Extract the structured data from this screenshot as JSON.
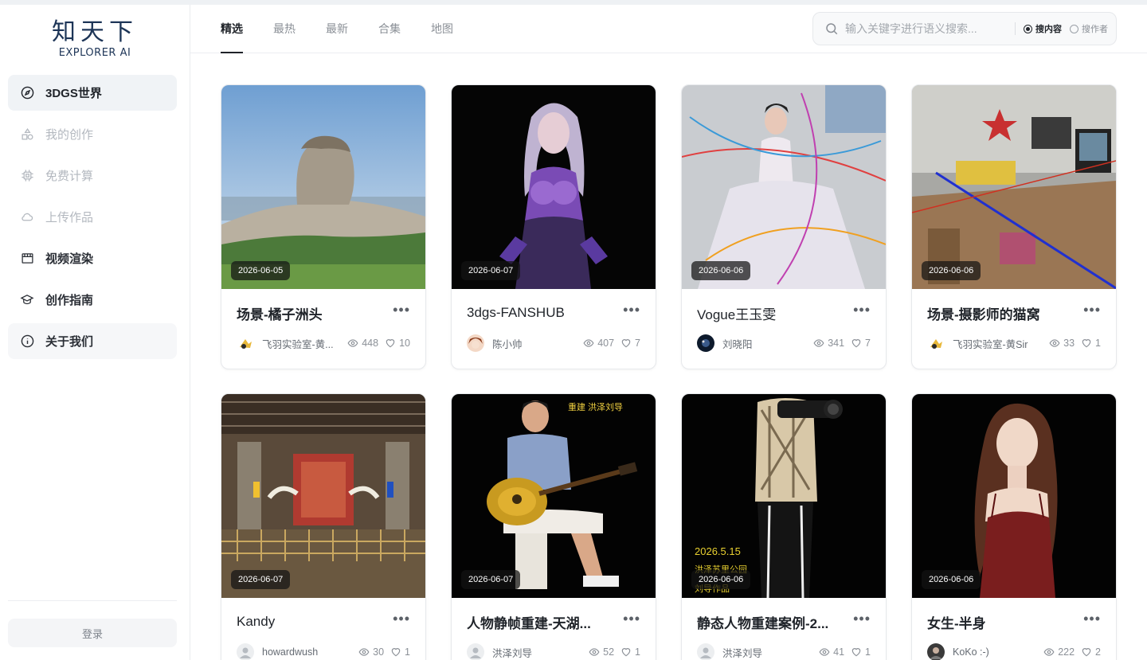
{
  "brand": {
    "name_cn": "知天下",
    "name_en": "EXPLORER AI"
  },
  "sidebar": {
    "items": [
      {
        "label": "3DGS世界",
        "icon": "compass-icon"
      },
      {
        "label": "我的创作",
        "icon": "shapes-icon"
      },
      {
        "label": "免费计算",
        "icon": "chip-icon"
      },
      {
        "label": "上传作品",
        "icon": "cloud-icon"
      },
      {
        "label": "视频渲染",
        "icon": "clapper-icon"
      },
      {
        "label": "创作指南",
        "icon": "graduation-cap-icon"
      },
      {
        "label": "关于我们",
        "icon": "info-icon"
      }
    ],
    "login_label": "登录"
  },
  "tabs": [
    "精选",
    "最热",
    "最新",
    "合集",
    "地图"
  ],
  "search": {
    "placeholder": "输入关键字进行语义搜索...",
    "options": [
      "搜内容",
      "搜作者"
    ],
    "selected": "搜内容"
  },
  "cards": [
    {
      "date": "2026-06-05",
      "title": "场景-橘子洲头",
      "author": "飞羽实验室-黄...",
      "views": "448",
      "likes": "10"
    },
    {
      "date": "2026-06-07",
      "title": "3dgs-FANSHUB",
      "author": "陈小帅",
      "views": "407",
      "likes": "7"
    },
    {
      "date": "2026-06-06",
      "title": "Vogue王玉雯",
      "author": "刘晓阳",
      "views": "341",
      "likes": "7"
    },
    {
      "date": "2026-06-06",
      "title": "场景-摄影师的猫窝",
      "author": "飞羽实验室-黄Sir",
      "views": "33",
      "likes": "1"
    },
    {
      "date": "2026-06-07",
      "title": "Kandy",
      "author": "howardwush",
      "views": "30",
      "likes": "1"
    },
    {
      "date": "2026-06-07",
      "title": "人物静帧重建-天湖...",
      "author": "洪泽刘导",
      "views": "52",
      "likes": "1",
      "overlay_text": [
        "重建  洪泽刘导"
      ]
    },
    {
      "date": "2026-06-06",
      "title": "静态人物重建案例-2...",
      "author": "洪泽刘导",
      "views": "41",
      "likes": "1",
      "overlay_text": [
        "2026.5.15",
        "洪泽苏里公园",
        "刘导作品"
      ]
    },
    {
      "date": "2026-06-06",
      "title": "女生-半身",
      "author": "KoKo :-)",
      "views": "222",
      "likes": "2"
    }
  ],
  "colors": {
    "accent": "#1f2329",
    "brand": "#1d3557",
    "muted": "#b3b8bf"
  }
}
